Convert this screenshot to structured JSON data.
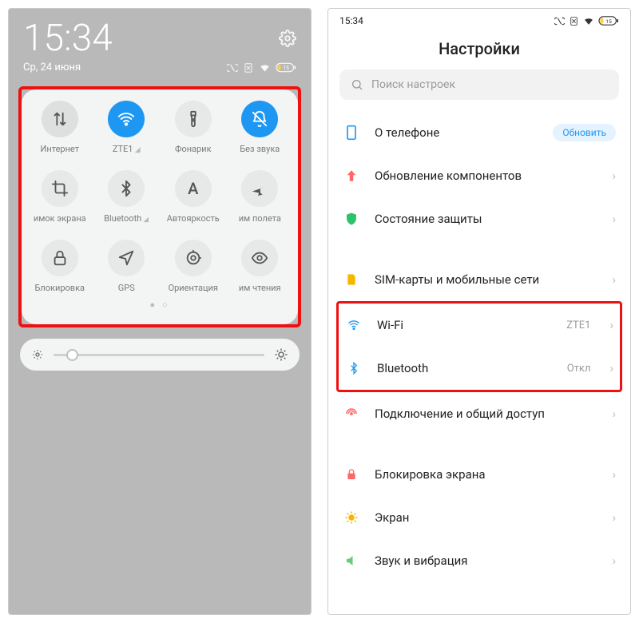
{
  "left": {
    "time": "15:34",
    "date": "Ср, 24 июня",
    "battery": "15",
    "tiles": [
      {
        "key": "internet",
        "label": "Интернет",
        "state": "muted",
        "icon": "data"
      },
      {
        "key": "wifi",
        "label": "ZTE1",
        "state": "active",
        "icon": "wifi",
        "signal": true
      },
      {
        "key": "flashlight",
        "label": "Фонарик",
        "state": "off",
        "icon": "torch"
      },
      {
        "key": "silent",
        "label": "Без звука",
        "state": "active",
        "icon": "mute"
      },
      {
        "key": "screenshot",
        "label": "имок экрана",
        "state": "off",
        "icon": "crop"
      },
      {
        "key": "bluetooth",
        "label": "Bluetooth",
        "state": "off",
        "icon": "bt",
        "signal": true
      },
      {
        "key": "autobright",
        "label": "Автояркость",
        "state": "off",
        "icon": "A"
      },
      {
        "key": "airplane",
        "label": "им полета",
        "state": "off",
        "icon": "plane"
      },
      {
        "key": "lock",
        "label": "Блокировка",
        "state": "off",
        "icon": "lock"
      },
      {
        "key": "gps",
        "label": "GPS",
        "state": "off",
        "icon": "nav"
      },
      {
        "key": "orientation",
        "label": "Ориентация",
        "state": "off",
        "icon": "rotate"
      },
      {
        "key": "read",
        "label": "им чтения",
        "state": "off",
        "icon": "eye"
      }
    ]
  },
  "right": {
    "time": "15:34",
    "battery": "15",
    "title": "Настройки",
    "search_placeholder": "Поиск настроек",
    "update_badge": "Обновить",
    "rows": {
      "about": "О телефоне",
      "updates": "Обновление компонентов",
      "security": "Состояние защиты",
      "sim": "SIM-карты и мобильные сети",
      "wifi": "Wi-Fi",
      "wifi_val": "ZTE1",
      "bt": "Bluetooth",
      "bt_val": "Откл",
      "tether": "Подключение и общий доступ",
      "lockscr": "Блокировка экрана",
      "display": "Экран",
      "sound": "Звук и вибрация"
    }
  }
}
